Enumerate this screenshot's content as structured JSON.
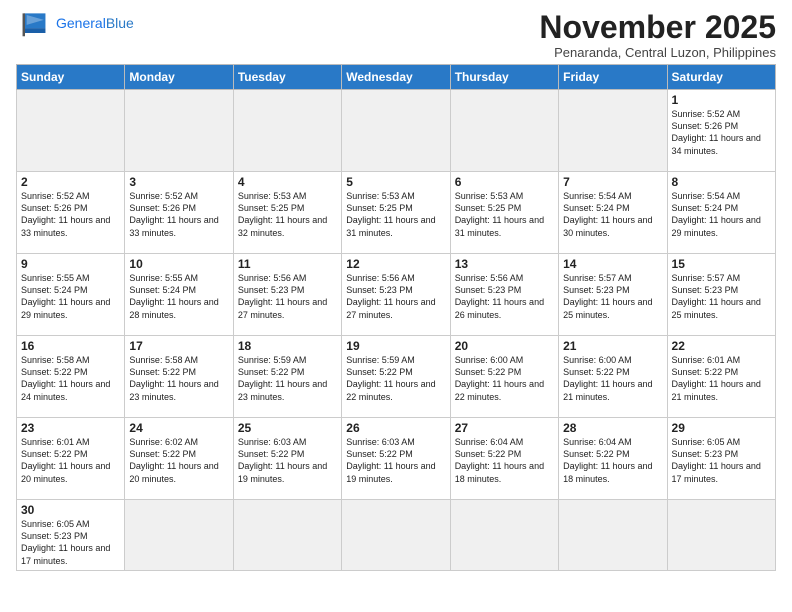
{
  "header": {
    "logo_general": "General",
    "logo_blue": "Blue",
    "month_title": "November 2025",
    "subtitle": "Penaranda, Central Luzon, Philippines"
  },
  "days_of_week": [
    "Sunday",
    "Monday",
    "Tuesday",
    "Wednesday",
    "Thursday",
    "Friday",
    "Saturday"
  ],
  "weeks": [
    [
      {
        "num": "",
        "empty": true
      },
      {
        "num": "",
        "empty": true
      },
      {
        "num": "",
        "empty": true
      },
      {
        "num": "",
        "empty": true
      },
      {
        "num": "",
        "empty": true
      },
      {
        "num": "",
        "empty": true
      },
      {
        "num": "1",
        "sunrise": "5:52 AM",
        "sunset": "5:26 PM",
        "daylight": "11 hours and 34 minutes."
      }
    ],
    [
      {
        "num": "2",
        "sunrise": "5:52 AM",
        "sunset": "5:26 PM",
        "daylight": "11 hours and 33 minutes."
      },
      {
        "num": "3",
        "sunrise": "5:52 AM",
        "sunset": "5:26 PM",
        "daylight": "11 hours and 33 minutes."
      },
      {
        "num": "4",
        "sunrise": "5:53 AM",
        "sunset": "5:25 PM",
        "daylight": "11 hours and 32 minutes."
      },
      {
        "num": "5",
        "sunrise": "5:53 AM",
        "sunset": "5:25 PM",
        "daylight": "11 hours and 31 minutes."
      },
      {
        "num": "6",
        "sunrise": "5:53 AM",
        "sunset": "5:25 PM",
        "daylight": "11 hours and 31 minutes."
      },
      {
        "num": "7",
        "sunrise": "5:54 AM",
        "sunset": "5:24 PM",
        "daylight": "11 hours and 30 minutes."
      },
      {
        "num": "8",
        "sunrise": "5:54 AM",
        "sunset": "5:24 PM",
        "daylight": "11 hours and 29 minutes."
      }
    ],
    [
      {
        "num": "9",
        "sunrise": "5:55 AM",
        "sunset": "5:24 PM",
        "daylight": "11 hours and 29 minutes."
      },
      {
        "num": "10",
        "sunrise": "5:55 AM",
        "sunset": "5:24 PM",
        "daylight": "11 hours and 28 minutes."
      },
      {
        "num": "11",
        "sunrise": "5:56 AM",
        "sunset": "5:23 PM",
        "daylight": "11 hours and 27 minutes."
      },
      {
        "num": "12",
        "sunrise": "5:56 AM",
        "sunset": "5:23 PM",
        "daylight": "11 hours and 27 minutes."
      },
      {
        "num": "13",
        "sunrise": "5:56 AM",
        "sunset": "5:23 PM",
        "daylight": "11 hours and 26 minutes."
      },
      {
        "num": "14",
        "sunrise": "5:57 AM",
        "sunset": "5:23 PM",
        "daylight": "11 hours and 25 minutes."
      },
      {
        "num": "15",
        "sunrise": "5:57 AM",
        "sunset": "5:23 PM",
        "daylight": "11 hours and 25 minutes."
      }
    ],
    [
      {
        "num": "16",
        "sunrise": "5:58 AM",
        "sunset": "5:22 PM",
        "daylight": "11 hours and 24 minutes."
      },
      {
        "num": "17",
        "sunrise": "5:58 AM",
        "sunset": "5:22 PM",
        "daylight": "11 hours and 23 minutes."
      },
      {
        "num": "18",
        "sunrise": "5:59 AM",
        "sunset": "5:22 PM",
        "daylight": "11 hours and 23 minutes."
      },
      {
        "num": "19",
        "sunrise": "5:59 AM",
        "sunset": "5:22 PM",
        "daylight": "11 hours and 22 minutes."
      },
      {
        "num": "20",
        "sunrise": "6:00 AM",
        "sunset": "5:22 PM",
        "daylight": "11 hours and 22 minutes."
      },
      {
        "num": "21",
        "sunrise": "6:00 AM",
        "sunset": "5:22 PM",
        "daylight": "11 hours and 21 minutes."
      },
      {
        "num": "22",
        "sunrise": "6:01 AM",
        "sunset": "5:22 PM",
        "daylight": "11 hours and 21 minutes."
      }
    ],
    [
      {
        "num": "23",
        "sunrise": "6:01 AM",
        "sunset": "5:22 PM",
        "daylight": "11 hours and 20 minutes."
      },
      {
        "num": "24",
        "sunrise": "6:02 AM",
        "sunset": "5:22 PM",
        "daylight": "11 hours and 20 minutes."
      },
      {
        "num": "25",
        "sunrise": "6:03 AM",
        "sunset": "5:22 PM",
        "daylight": "11 hours and 19 minutes."
      },
      {
        "num": "26",
        "sunrise": "6:03 AM",
        "sunset": "5:22 PM",
        "daylight": "11 hours and 19 minutes."
      },
      {
        "num": "27",
        "sunrise": "6:04 AM",
        "sunset": "5:22 PM",
        "daylight": "11 hours and 18 minutes."
      },
      {
        "num": "28",
        "sunrise": "6:04 AM",
        "sunset": "5:22 PM",
        "daylight": "11 hours and 18 minutes."
      },
      {
        "num": "29",
        "sunrise": "6:05 AM",
        "sunset": "5:23 PM",
        "daylight": "11 hours and 17 minutes."
      }
    ],
    [
      {
        "num": "30",
        "sunrise": "6:05 AM",
        "sunset": "5:23 PM",
        "daylight": "11 hours and 17 minutes.",
        "last": true
      },
      {
        "num": "",
        "empty": true,
        "last": true
      },
      {
        "num": "",
        "empty": true,
        "last": true
      },
      {
        "num": "",
        "empty": true,
        "last": true
      },
      {
        "num": "",
        "empty": true,
        "last": true
      },
      {
        "num": "",
        "empty": true,
        "last": true
      },
      {
        "num": "",
        "empty": true,
        "last": true
      }
    ]
  ],
  "labels": {
    "sunrise": "Sunrise:",
    "sunset": "Sunset:",
    "daylight": "Daylight:"
  }
}
